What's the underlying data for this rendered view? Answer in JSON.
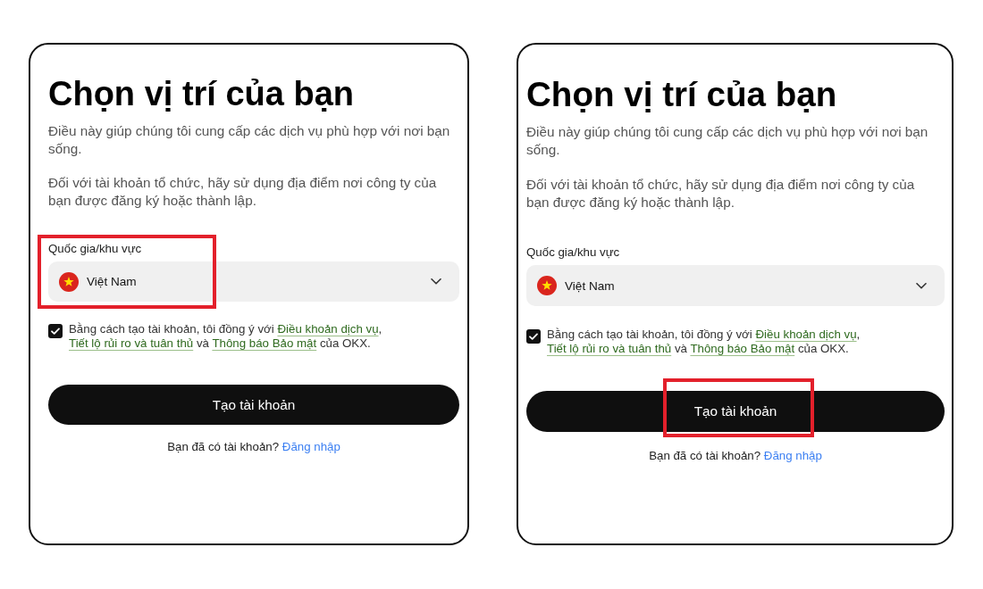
{
  "panels": [
    {
      "title": "Chọn vị trí của bạn",
      "intro": "Điều này giúp chúng tôi cung cấp các dịch vụ phù hợp với nơi bạn sống.",
      "note": "Đối với tài khoản tổ chức, hãy sử dụng địa điểm nơi công ty của bạn được đăng ký hoặc thành lập.",
      "country_field": {
        "label": "Quốc gia/khu vực",
        "value": "Việt Nam",
        "highlighted": true
      },
      "consent": {
        "checked": true,
        "parts": [
          {
            "kind": "text",
            "text": "Bằng cách tạo tài khoản, tôi đồng ý với "
          },
          {
            "kind": "link",
            "text": "Điều khoản dịch vụ"
          },
          {
            "kind": "text",
            "text": ", "
          },
          {
            "kind": "link",
            "text": "Tiết lộ rủi ro và tuân thủ"
          },
          {
            "kind": "text",
            "text": " và "
          },
          {
            "kind": "link",
            "text": "Thông báo Bảo mật"
          },
          {
            "kind": "text",
            "text": " của OKX."
          }
        ]
      },
      "create_button": {
        "label": "Tạo tài khoản",
        "highlighted": false
      },
      "signin": {
        "prompt": "Bạn đã có tài khoản?",
        "link": "Đăng nhập"
      }
    },
    {
      "title": "Chọn vị trí của bạn",
      "intro": "Điều này giúp chúng tôi cung cấp các dịch vụ phù hợp với nơi bạn sống.",
      "note": "Đối với tài khoản tổ chức, hãy sử dụng địa điểm nơi công ty của bạn được đăng ký hoặc thành lập.",
      "country_field": {
        "label": "Quốc gia/khu vực",
        "value": "Việt Nam",
        "highlighted": false
      },
      "consent": {
        "checked": true,
        "parts": [
          {
            "kind": "text",
            "text": "Bằng cách tạo tài khoản, tôi đồng ý với "
          },
          {
            "kind": "link",
            "text": "Điều khoản dịch vụ"
          },
          {
            "kind": "text",
            "text": ", "
          },
          {
            "kind": "link",
            "text": "Tiết lộ rủi ro và tuân thủ"
          },
          {
            "kind": "text",
            "text": " và "
          },
          {
            "kind": "link",
            "text": "Thông báo Bảo mật"
          },
          {
            "kind": "text",
            "text": " của OKX."
          }
        ]
      },
      "create_button": {
        "label": "Tạo tài khoản",
        "highlighted": true
      },
      "signin": {
        "prompt": "Bạn đã có tài khoản?",
        "link": "Đăng nhập"
      }
    }
  ]
}
